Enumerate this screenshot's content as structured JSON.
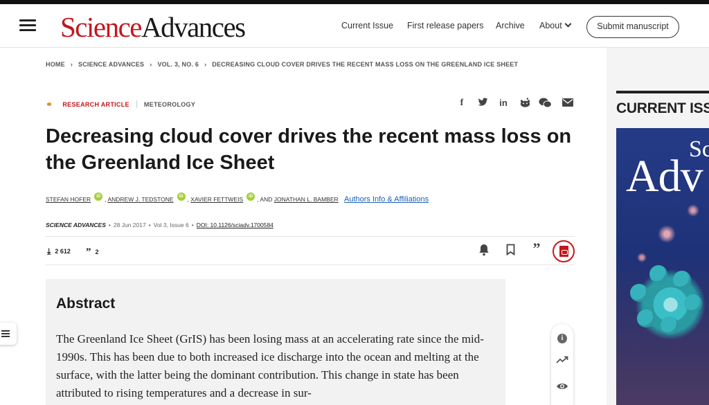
{
  "header": {
    "logo_science": "Science",
    "logo_advances": "Advances",
    "nav": [
      "Current Issue",
      "First release papers",
      "Archive",
      "About"
    ],
    "submit_label": "Submit manuscript"
  },
  "breadcrumb": [
    "HOME",
    "SCIENCE ADVANCES",
    "VOL. 3, NO. 6",
    "DECREASING CLOUD COVER DRIVES THE RECENT MASS LOSS ON THE GREENLAND ICE SHEET"
  ],
  "article": {
    "type": "RESEARCH ARTICLE",
    "subject": "METEOROLOGY",
    "title": "Decreasing cloud cover drives the recent mass loss on the Greenland Ice Sheet",
    "authors": [
      "STEFAN HOFER",
      "ANDREW J. TEDSTONE",
      "XAVIER FETTWEIS",
      "JONATHAN L. BAMBER"
    ],
    "and_text": ", AND",
    "affiliations_link": "Authors Info & Affiliations",
    "journal": "SCIENCE ADVANCES",
    "date": "28 Jun 2017",
    "volume": "Vol 3, Issue 6",
    "doi": "DOI: 10.1126/sciadv.1700584",
    "downloads": "2 612",
    "citations": "2"
  },
  "abstract": {
    "heading": "Abstract",
    "text": "The Greenland Ice Sheet (GrIS) has been losing mass at an accelerating rate since the mid-1990s. This has been due to both increased ice discharge into the ocean and melting at the surface, with the latter being the dominant contribution. This change in state has been attributed to rising temperatures and a decrease in sur-"
  },
  "sidebar": {
    "heading": "CURRENT ISSUE",
    "cover_sc": "Sc",
    "cover_adv": "Adv"
  },
  "icons": {
    "open_access": "open-access-lock-icon",
    "share": [
      "facebook-icon",
      "twitter-icon",
      "linkedin-icon",
      "reddit-icon",
      "wechat-icon",
      "email-icon"
    ],
    "tools": [
      "bell-icon",
      "bookmark-icon",
      "quote-icon",
      "pdf-icon"
    ],
    "float": [
      "info-icon",
      "trending-icon",
      "eye-icon"
    ]
  },
  "colors": {
    "brand_red": "#c4161c",
    "orcid_green": "#a6ce39",
    "link_blue": "#1a5fb4",
    "open_access_orange": "#e08a1e"
  }
}
